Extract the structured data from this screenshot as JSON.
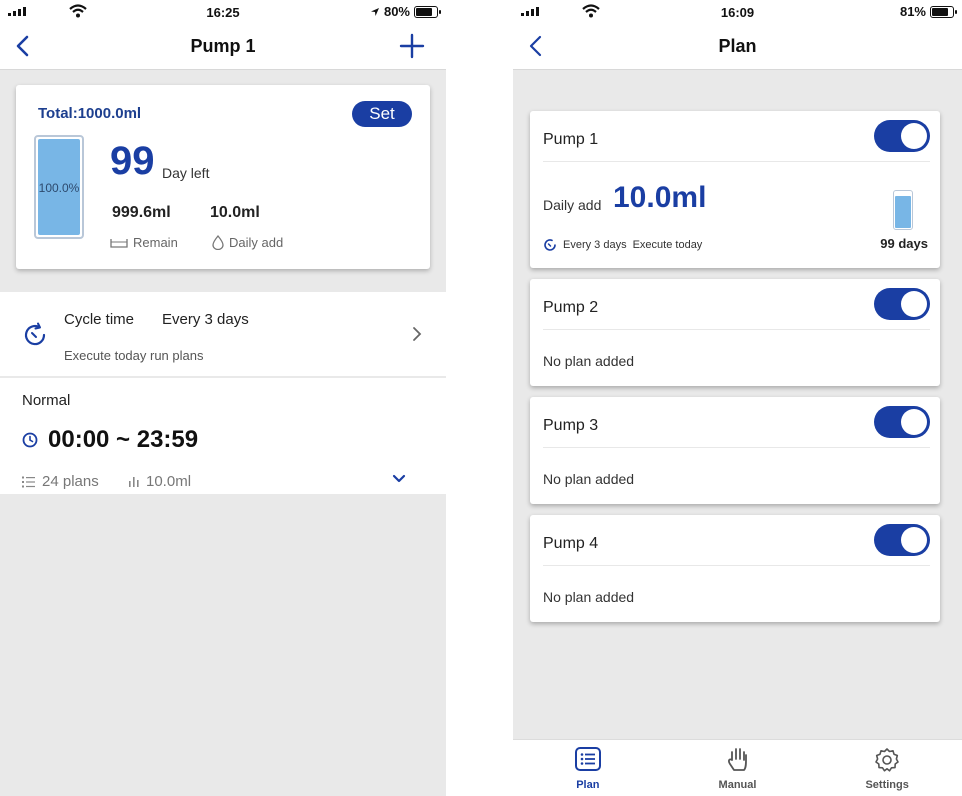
{
  "left": {
    "status": {
      "time": "16:25",
      "battery": "80%",
      "battery_level": 0.8
    },
    "nav": {
      "title": "Pump 1"
    },
    "summary": {
      "total": "Total:1000.0ml",
      "set_label": "Set",
      "tank_percent": "100.0%",
      "tank_level": 1.0,
      "days": "99",
      "days_unit": "Day left",
      "remain_value": "999.6ml",
      "remain_label": "Remain",
      "daily_value": "10.0ml",
      "daily_label": "Daily add"
    },
    "cycle": {
      "title": "Cycle time",
      "value": "Every 3 days",
      "subtitle": "Execute today run plans"
    },
    "mode": {
      "name": "Normal",
      "time_range": "00:00 ~ 23:59",
      "plans": "24 plans",
      "volume": "10.0ml"
    }
  },
  "right": {
    "status": {
      "time": "16:09",
      "battery": "81%",
      "battery_level": 0.81
    },
    "nav": {
      "title": "Plan"
    },
    "pumps": [
      {
        "name": "Pump 1",
        "enabled": true,
        "daily_label": "Daily add",
        "daily_value": "10.0ml",
        "schedule": "Every 3 days",
        "execute": "Execute today",
        "days_left": "99 days",
        "tank_level": 0.9
      },
      {
        "name": "Pump 2",
        "enabled": true,
        "empty_text": "No plan added"
      },
      {
        "name": "Pump 3",
        "enabled": true,
        "empty_text": "No plan added"
      },
      {
        "name": "Pump 4",
        "enabled": true,
        "empty_text": "No plan added"
      }
    ],
    "tabs": [
      {
        "label": "Plan",
        "icon": "plan-list-icon",
        "active": true
      },
      {
        "label": "Manual",
        "icon": "hand-icon",
        "active": false
      },
      {
        "label": "Settings",
        "icon": "gear-icon",
        "active": false
      }
    ]
  },
  "colors": {
    "accent": "#1a3ea3",
    "tank_fill": "#78b6e6",
    "background": "#e9e9e9"
  }
}
